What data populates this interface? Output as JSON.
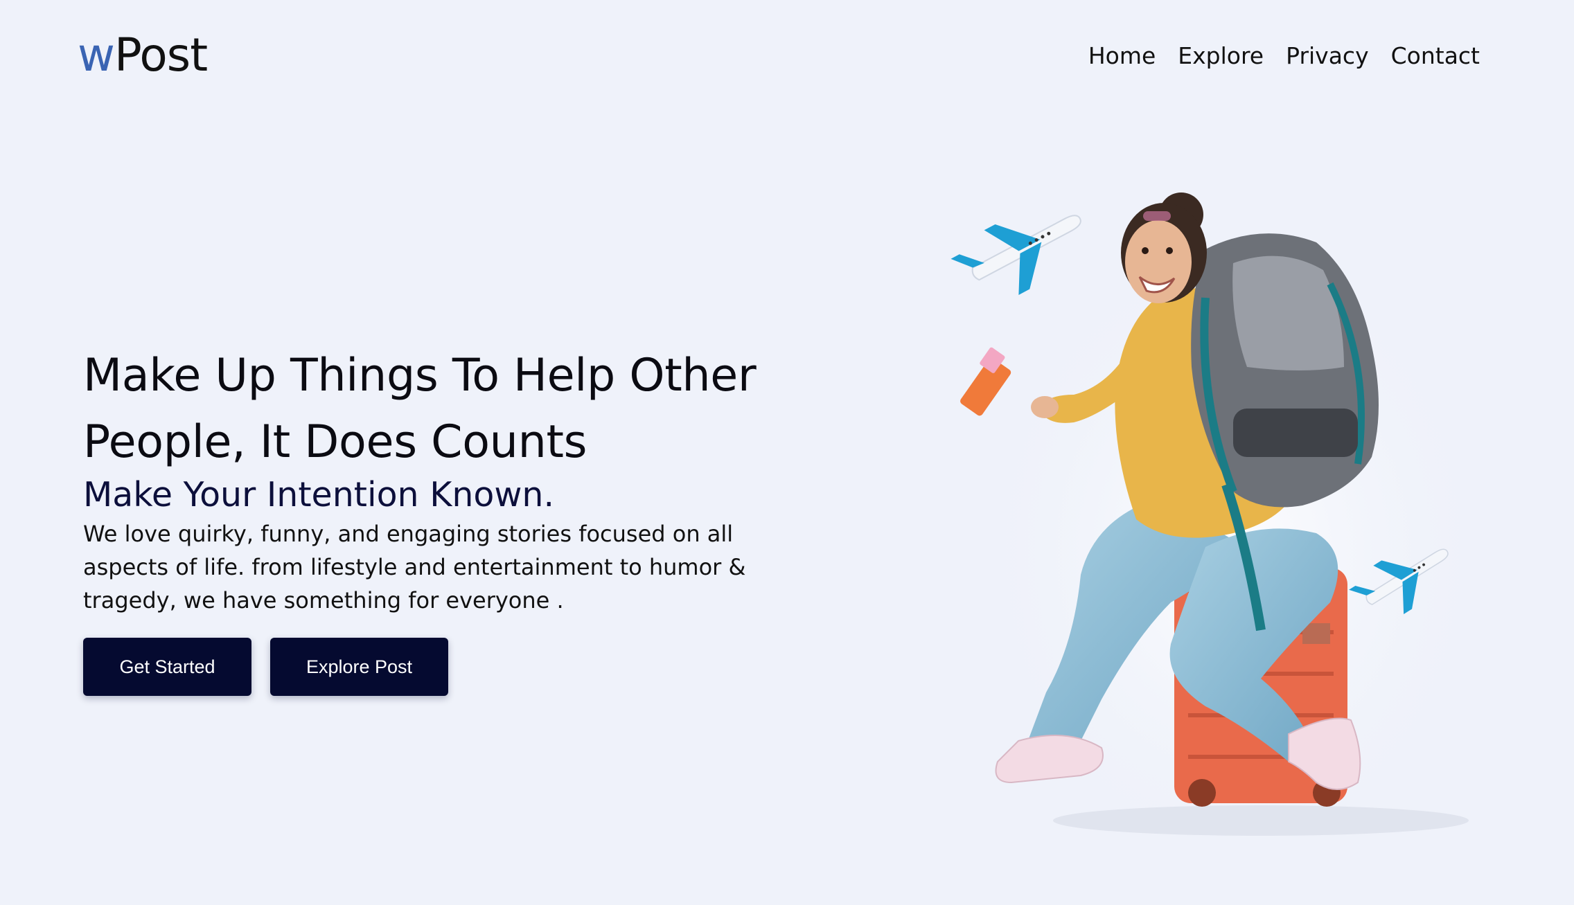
{
  "header": {
    "logo_prefix": "w",
    "logo_suffix": "Post",
    "nav": [
      "Home",
      "Explore",
      "Privacy",
      "Contact"
    ]
  },
  "hero": {
    "title_line1": "Make Up Things To Help Other",
    "title_line2": "People, It Does Counts",
    "subtitle": "Make Your Intention Known.",
    "description_line1": "We love quirky, funny, and engaging stories focused on all",
    "description_line2": "aspects of life. from lifestyle and entertainment to humor &",
    "description_line3": "tragedy, we have something for everyone .",
    "buttons": {
      "get_started": "Get Started",
      "explore_post": "Explore Post"
    }
  },
  "colors": {
    "background": "#eff2fa",
    "logo_accent": "#3a64b3",
    "button": "#050a30",
    "subtitle": "#0c0f3b",
    "plane_blue": "#1e9fd4",
    "suitcase": "#e96a4b",
    "hoodie": "#e8b54a",
    "jeans": "#8bbcd6",
    "backpack": "#6d7178"
  },
  "icons": {
    "plane": "airplane-icon"
  }
}
